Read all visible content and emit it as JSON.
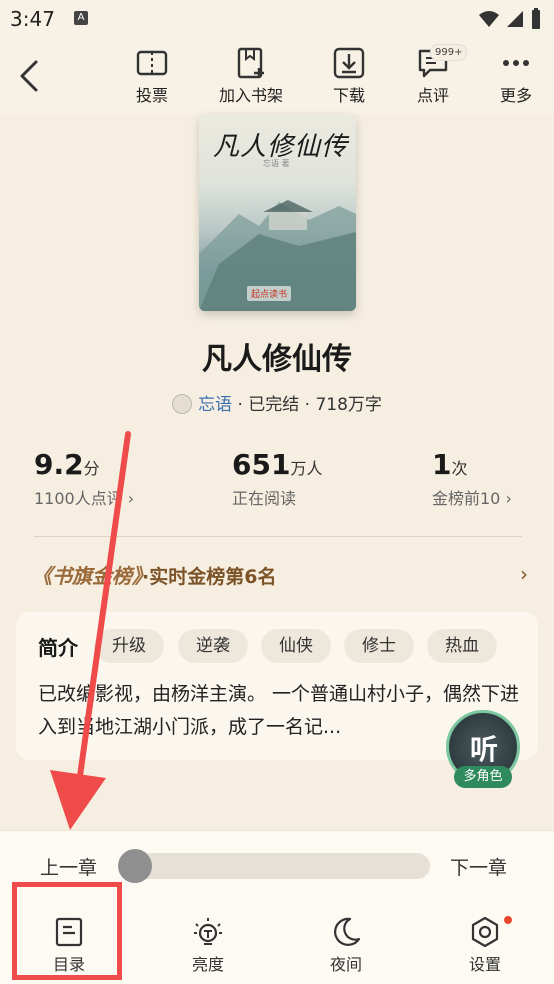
{
  "status_bar": {
    "time": "3:47",
    "notif_badge": "A"
  },
  "toolbar": {
    "items": [
      {
        "label": "投票",
        "icon": "ticket-icon"
      },
      {
        "label": "加入书架",
        "icon": "bookshelf-add-icon"
      },
      {
        "label": "下载",
        "icon": "download-icon"
      },
      {
        "label": "点评",
        "icon": "comment-icon"
      },
      {
        "label": "更多",
        "icon": "more-icon"
      }
    ],
    "comment_badge": "999+"
  },
  "book": {
    "cover_title": "凡人修仙传",
    "cover_author": "忘语 著",
    "cover_publisher": "起点读书",
    "title": "凡人修仙传",
    "author": "忘语",
    "meta_rest": " · 已完结 · 718万字"
  },
  "stats": [
    {
      "big": "9.2",
      "unit": "分",
      "sub": "1100人点评 ›"
    },
    {
      "big": "651",
      "unit": "万人",
      "sub": "正在阅读"
    },
    {
      "big": "1",
      "unit": "次",
      "sub": "金榜前10 ›"
    }
  ],
  "rank": {
    "flag": "《书旗金榜》",
    "text": "·实时金榜第6名",
    "chev": "›"
  },
  "intro": {
    "head": "简介",
    "tags": [
      "升级",
      "逆袭",
      "仙侠",
      "修士",
      "热血"
    ],
    "desc": "已改编影视，由杨洋主演。 一个普通山村小子，偶然下进入到当地江湖小门派，成了一名记..."
  },
  "listen": {
    "char": "听",
    "role": "多角色"
  },
  "bottom": {
    "prev": "上一章",
    "next": "下一章",
    "progress": 0,
    "nav": [
      {
        "label": "目录",
        "icon": "catalog-icon"
      },
      {
        "label": "亮度",
        "icon": "brightness-icon"
      },
      {
        "label": "夜间",
        "icon": "moon-icon"
      },
      {
        "label": "设置",
        "icon": "settings-icon"
      }
    ]
  },
  "colors": {
    "annotation": "#ef4b4b",
    "accent_brown": "#7c5428",
    "link_blue": "#3c6fb0",
    "listen_green": "#2f8a5e"
  }
}
